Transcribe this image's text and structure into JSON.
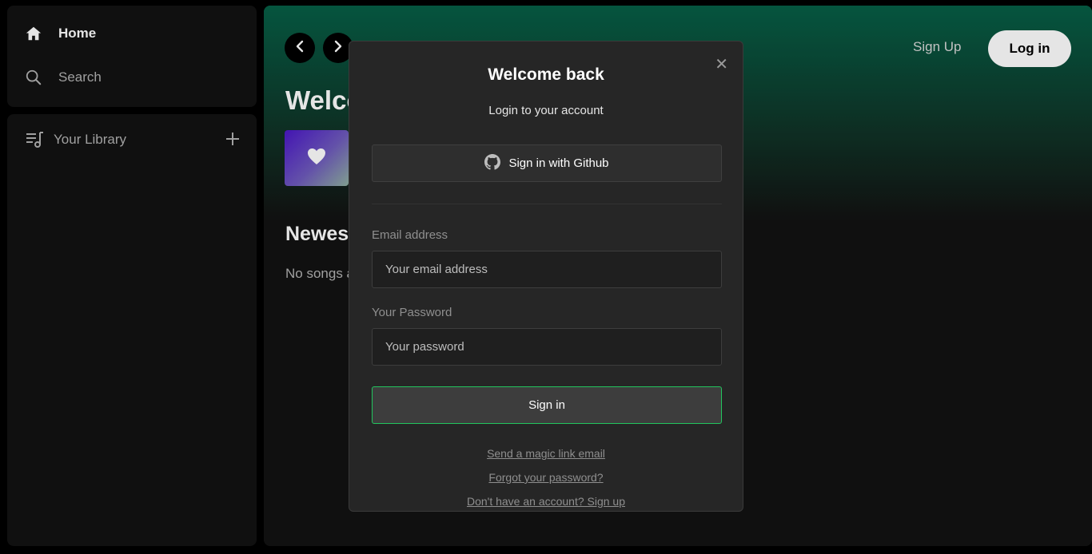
{
  "sidebar": {
    "nav": [
      {
        "label": "Home",
        "icon": "home-icon"
      },
      {
        "label": "Search",
        "icon": "search-icon"
      }
    ],
    "library": {
      "label": "Your Library",
      "icon": "library-icon",
      "add_icon": "plus-icon"
    }
  },
  "header": {
    "signup_label": "Sign Up",
    "login_label": "Log in"
  },
  "main": {
    "welcome_title": "Welcome back",
    "liked_card_icon": "heart-icon",
    "section_title": "Newest songs",
    "empty_text": "No songs available."
  },
  "modal": {
    "title": "Welcome back",
    "subtitle": "Login to your account",
    "github_label": "Sign in with Github",
    "email_label": "Email address",
    "email_placeholder": "Your email address",
    "password_label": "Your Password",
    "password_placeholder": "Your password",
    "signin_label": "Sign in",
    "magic_link": "Send a magic link email",
    "forgot_link": "Forgot your password?",
    "signup_link": "Don't have an account? Sign up",
    "close_icon": "close-icon"
  },
  "colors": {
    "accent_green": "#22c55e",
    "header_gradient_top": "#065f46",
    "panel_bg": "#121212",
    "modal_bg": "#262626"
  }
}
